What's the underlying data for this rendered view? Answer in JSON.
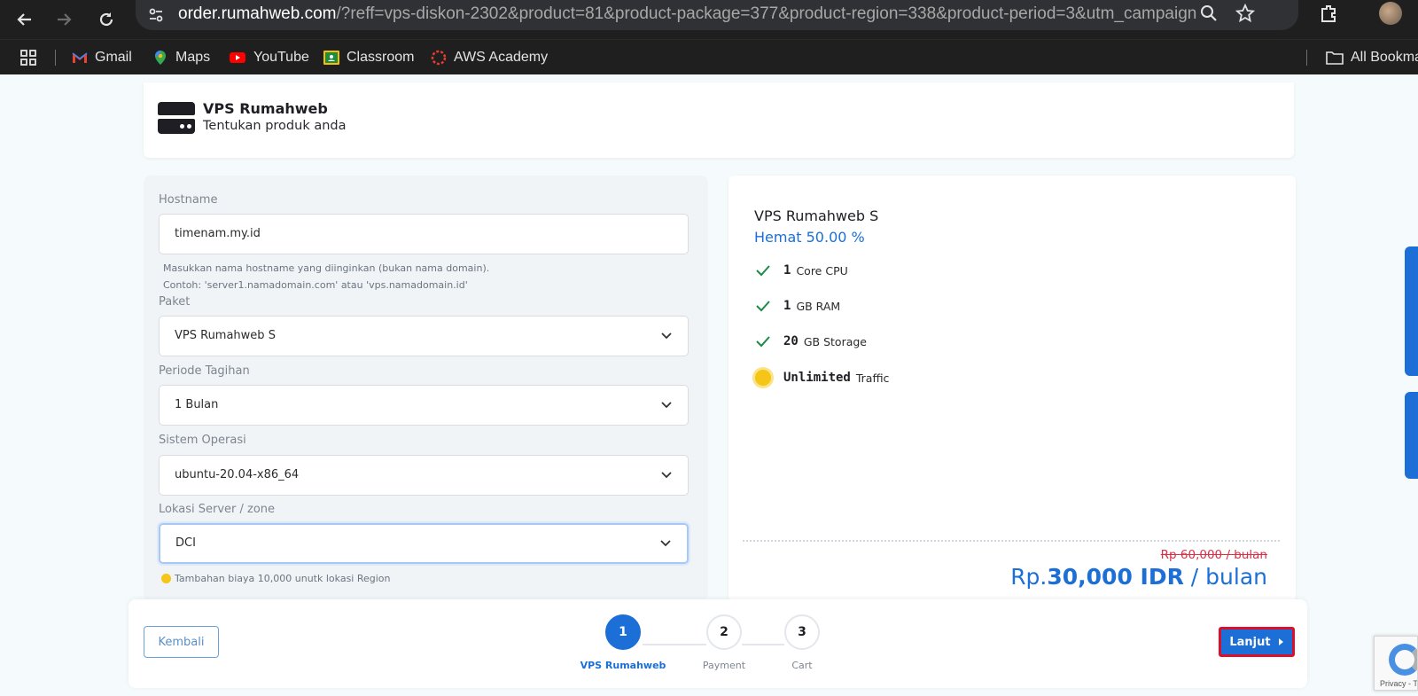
{
  "browser": {
    "url_host": "order.rumahweb.com",
    "url_rest": "/?reff=vps-diskon-2302&product=81&product-package=377&product-region=338&product-period=3&utm_campaign=v...",
    "bookmarks": [
      "Gmail",
      "Maps",
      "YouTube",
      "Classroom",
      "AWS Academy"
    ],
    "all_bookmarks": "All Bookma"
  },
  "header": {
    "title": "VPS Rumahweb",
    "subtitle": "Tentukan produk anda"
  },
  "form": {
    "hostname_label": "Hostname",
    "hostname_value": "timenam.my.id",
    "hostname_help_1": "Masukkan nama hostname yang diinginkan (bukan nama domain).",
    "hostname_help_2": "Contoh: 'server1.namadomain.com' atau 'vps.namadomain.id'",
    "package_label": "Paket",
    "package_value": "VPS Rumahweb S",
    "period_label": "Periode Tagihan",
    "period_value": "1 Bulan",
    "os_label": "Sistem Operasi",
    "os_value": "ubuntu-20.04-x86_64",
    "location_label": "Lokasi Server / zone",
    "location_value": "DCI",
    "location_note": "Tambahan biaya 10,000 unutk lokasi Region"
  },
  "summary": {
    "product": "VPS Rumahweb S",
    "discount": "Hemat 50.00 %",
    "specs": [
      {
        "num": "1",
        "unit": "Core CPU"
      },
      {
        "num": "1",
        "unit": "GB RAM"
      },
      {
        "num": "20",
        "unit": "GB Storage"
      },
      {
        "num": "Unlimited",
        "unit": "Traffic"
      }
    ],
    "old_price": "Rp 60,000 / bulan",
    "price_prefix": "Rp.",
    "price_amount": "30,000 IDR",
    "price_suffix": " / bulan"
  },
  "footer": {
    "back_label": "Kembali",
    "next_label": "Lanjut",
    "steps": [
      {
        "num": "1",
        "label": "VPS Rumahweb"
      },
      {
        "num": "2",
        "label": "Payment"
      },
      {
        "num": "3",
        "label": "Cart"
      }
    ]
  },
  "recaptcha": {
    "text": "Privacy - Te"
  },
  "colors": {
    "accent": "#1b6fd6",
    "strike": "#d6334a",
    "highlight_border": "#d8102e"
  }
}
